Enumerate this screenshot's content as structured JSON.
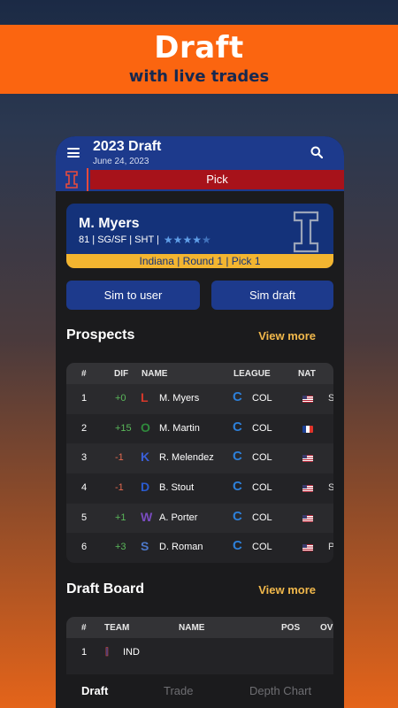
{
  "promo": {
    "title": "Draft",
    "subtitle": "with live trades"
  },
  "header": {
    "title": "2023 Draft",
    "date": "June 24, 2023"
  },
  "pick_bar": {
    "label": "Pick"
  },
  "player_card": {
    "name": "M. Myers",
    "info": "81 | SG/SF | SHT |",
    "rating_stars": 4.5,
    "footer": "Indiana | Round 1 | Pick 1"
  },
  "buttons": {
    "sim_to_user": "Sim to user",
    "sim_draft": "Sim draft"
  },
  "prospects": {
    "title": "Prospects",
    "view_more": "View more",
    "columns": [
      "#",
      "DIF",
      "NAME",
      "LEAGUE",
      "NAT"
    ],
    "rows": [
      {
        "num": "1",
        "dif": "+0",
        "dif_sign": "pos",
        "team_letter": "L",
        "team_color": "#d6382a",
        "name": "M. Myers",
        "league": "COL",
        "flag": "us",
        "extra": "S"
      },
      {
        "num": "2",
        "dif": "+15",
        "dif_sign": "pos",
        "team_letter": "O",
        "team_color": "#2f8a3c",
        "name": "M. Martin",
        "league": "COL",
        "flag": "fr",
        "extra": ""
      },
      {
        "num": "3",
        "dif": "-1",
        "dif_sign": "neg",
        "team_letter": "K",
        "team_color": "#3a5fd8",
        "name": "R. Melendez",
        "league": "COL",
        "flag": "us",
        "extra": ""
      },
      {
        "num": "4",
        "dif": "-1",
        "dif_sign": "neg",
        "team_letter": "D",
        "team_color": "#2a5bd0",
        "name": "B. Stout",
        "league": "COL",
        "flag": "us",
        "extra": "S"
      },
      {
        "num": "5",
        "dif": "+1",
        "dif_sign": "pos",
        "team_letter": "W",
        "team_color": "#7a4cc0",
        "name": "A. Porter",
        "league": "COL",
        "flag": "us",
        "extra": ""
      },
      {
        "num": "6",
        "dif": "+3",
        "dif_sign": "pos",
        "team_letter": "S",
        "team_color": "#4d78c8",
        "name": "D. Roman",
        "league": "COL",
        "flag": "us",
        "extra": "P"
      }
    ]
  },
  "draft_board": {
    "title": "Draft Board",
    "view_more": "View more",
    "columns": [
      "#",
      "TEAM",
      "NAME",
      "POS",
      "OV"
    ],
    "rows": [
      {
        "num": "1",
        "team_letter": "I",
        "team": "IND"
      }
    ]
  },
  "bottom_nav": {
    "draft": "Draft",
    "trade": "Trade",
    "depth_chart": "Depth Chart"
  },
  "colors": {
    "accent_orange": "#fb6510",
    "primary_blue": "#1d3a8c",
    "pick_red": "#a7121a",
    "gold": "#f3b530"
  }
}
